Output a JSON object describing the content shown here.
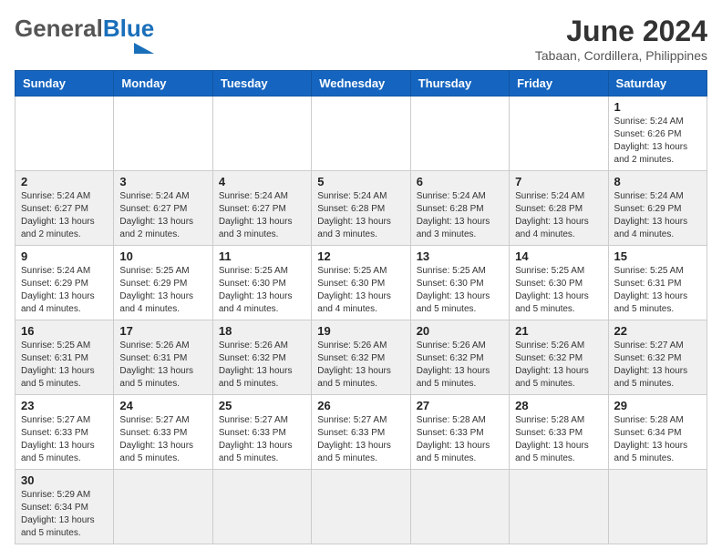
{
  "header": {
    "logo_general": "General",
    "logo_blue": "Blue",
    "month_title": "June 2024",
    "location": "Tabaan, Cordillera, Philippines"
  },
  "weekdays": [
    "Sunday",
    "Monday",
    "Tuesday",
    "Wednesday",
    "Thursday",
    "Friday",
    "Saturday"
  ],
  "weeks": [
    [
      {
        "day": "",
        "info": ""
      },
      {
        "day": "",
        "info": ""
      },
      {
        "day": "",
        "info": ""
      },
      {
        "day": "",
        "info": ""
      },
      {
        "day": "",
        "info": ""
      },
      {
        "day": "",
        "info": ""
      },
      {
        "day": "1",
        "info": "Sunrise: 5:24 AM\nSunset: 6:26 PM\nDaylight: 13 hours and 2 minutes."
      }
    ],
    [
      {
        "day": "2",
        "info": "Sunrise: 5:24 AM\nSunset: 6:27 PM\nDaylight: 13 hours and 2 minutes."
      },
      {
        "day": "3",
        "info": "Sunrise: 5:24 AM\nSunset: 6:27 PM\nDaylight: 13 hours and 2 minutes."
      },
      {
        "day": "4",
        "info": "Sunrise: 5:24 AM\nSunset: 6:27 PM\nDaylight: 13 hours and 3 minutes."
      },
      {
        "day": "5",
        "info": "Sunrise: 5:24 AM\nSunset: 6:28 PM\nDaylight: 13 hours and 3 minutes."
      },
      {
        "day": "6",
        "info": "Sunrise: 5:24 AM\nSunset: 6:28 PM\nDaylight: 13 hours and 3 minutes."
      },
      {
        "day": "7",
        "info": "Sunrise: 5:24 AM\nSunset: 6:28 PM\nDaylight: 13 hours and 4 minutes."
      },
      {
        "day": "8",
        "info": "Sunrise: 5:24 AM\nSunset: 6:29 PM\nDaylight: 13 hours and 4 minutes."
      }
    ],
    [
      {
        "day": "9",
        "info": "Sunrise: 5:24 AM\nSunset: 6:29 PM\nDaylight: 13 hours and 4 minutes."
      },
      {
        "day": "10",
        "info": "Sunrise: 5:25 AM\nSunset: 6:29 PM\nDaylight: 13 hours and 4 minutes."
      },
      {
        "day": "11",
        "info": "Sunrise: 5:25 AM\nSunset: 6:30 PM\nDaylight: 13 hours and 4 minutes."
      },
      {
        "day": "12",
        "info": "Sunrise: 5:25 AM\nSunset: 6:30 PM\nDaylight: 13 hours and 4 minutes."
      },
      {
        "day": "13",
        "info": "Sunrise: 5:25 AM\nSunset: 6:30 PM\nDaylight: 13 hours and 5 minutes."
      },
      {
        "day": "14",
        "info": "Sunrise: 5:25 AM\nSunset: 6:30 PM\nDaylight: 13 hours and 5 minutes."
      },
      {
        "day": "15",
        "info": "Sunrise: 5:25 AM\nSunset: 6:31 PM\nDaylight: 13 hours and 5 minutes."
      }
    ],
    [
      {
        "day": "16",
        "info": "Sunrise: 5:25 AM\nSunset: 6:31 PM\nDaylight: 13 hours and 5 minutes."
      },
      {
        "day": "17",
        "info": "Sunrise: 5:26 AM\nSunset: 6:31 PM\nDaylight: 13 hours and 5 minutes."
      },
      {
        "day": "18",
        "info": "Sunrise: 5:26 AM\nSunset: 6:32 PM\nDaylight: 13 hours and 5 minutes."
      },
      {
        "day": "19",
        "info": "Sunrise: 5:26 AM\nSunset: 6:32 PM\nDaylight: 13 hours and 5 minutes."
      },
      {
        "day": "20",
        "info": "Sunrise: 5:26 AM\nSunset: 6:32 PM\nDaylight: 13 hours and 5 minutes."
      },
      {
        "day": "21",
        "info": "Sunrise: 5:26 AM\nSunset: 6:32 PM\nDaylight: 13 hours and 5 minutes."
      },
      {
        "day": "22",
        "info": "Sunrise: 5:27 AM\nSunset: 6:32 PM\nDaylight: 13 hours and 5 minutes."
      }
    ],
    [
      {
        "day": "23",
        "info": "Sunrise: 5:27 AM\nSunset: 6:33 PM\nDaylight: 13 hours and 5 minutes."
      },
      {
        "day": "24",
        "info": "Sunrise: 5:27 AM\nSunset: 6:33 PM\nDaylight: 13 hours and 5 minutes."
      },
      {
        "day": "25",
        "info": "Sunrise: 5:27 AM\nSunset: 6:33 PM\nDaylight: 13 hours and 5 minutes."
      },
      {
        "day": "26",
        "info": "Sunrise: 5:27 AM\nSunset: 6:33 PM\nDaylight: 13 hours and 5 minutes."
      },
      {
        "day": "27",
        "info": "Sunrise: 5:28 AM\nSunset: 6:33 PM\nDaylight: 13 hours and 5 minutes."
      },
      {
        "day": "28",
        "info": "Sunrise: 5:28 AM\nSunset: 6:33 PM\nDaylight: 13 hours and 5 minutes."
      },
      {
        "day": "29",
        "info": "Sunrise: 5:28 AM\nSunset: 6:34 PM\nDaylight: 13 hours and 5 minutes."
      }
    ],
    [
      {
        "day": "30",
        "info": "Sunrise: 5:29 AM\nSunset: 6:34 PM\nDaylight: 13 hours and 5 minutes."
      },
      {
        "day": "",
        "info": ""
      },
      {
        "day": "",
        "info": ""
      },
      {
        "day": "",
        "info": ""
      },
      {
        "day": "",
        "info": ""
      },
      {
        "day": "",
        "info": ""
      },
      {
        "day": "",
        "info": ""
      }
    ]
  ],
  "colors": {
    "header_bg": "#1565c0",
    "logo_blue": "#1a6fba"
  }
}
